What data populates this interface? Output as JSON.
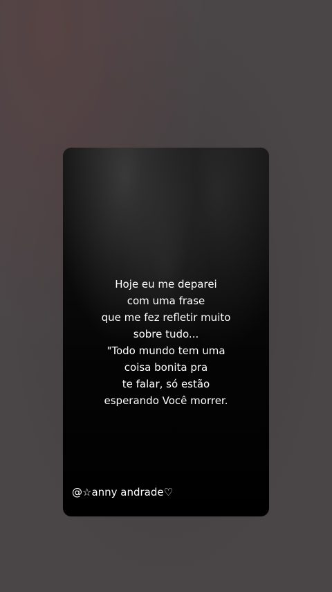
{
  "story": {
    "quote_lines": [
      "Hoje eu me deparei",
      "com uma frase",
      "que me fez refletir muito",
      "sobre tudo...",
      "\"Todo mundo tem uma",
      "coisa bonita pra",
      "te falar, só estão",
      "esperando Você morrer."
    ],
    "handle": "@☆anny andrade♡"
  },
  "colors": {
    "background": "#4a4648",
    "card": "#000000",
    "text": "#ffffff"
  }
}
